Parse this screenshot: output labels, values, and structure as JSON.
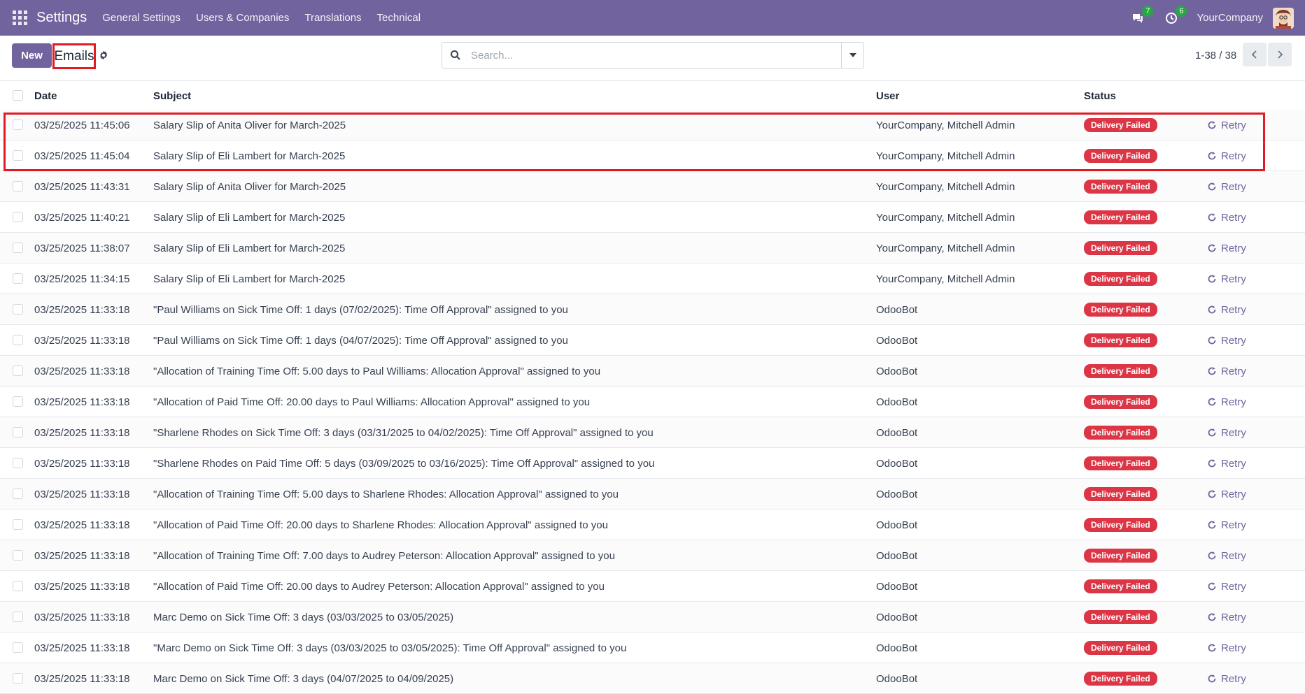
{
  "navbar": {
    "app_name": "Settings",
    "menu": [
      "General Settings",
      "Users & Companies",
      "Translations",
      "Technical"
    ],
    "messages_count": "7",
    "activities_count": "6",
    "company": "YourCompany"
  },
  "control": {
    "new_label": "New",
    "title": "Emails",
    "search_placeholder": "Search...",
    "pager": "1-38 / 38"
  },
  "table": {
    "columns": [
      "Date",
      "Subject",
      "User",
      "Status"
    ],
    "rows": [
      {
        "date": "03/25/2025 11:45:06",
        "subject": "Salary Slip of Anita Oliver for March-2025",
        "user": "YourCompany, Mitchell Admin",
        "status": "Delivery Failed",
        "action": "Retry"
      },
      {
        "date": "03/25/2025 11:45:04",
        "subject": "Salary Slip of Eli Lambert for March-2025",
        "user": "YourCompany, Mitchell Admin",
        "status": "Delivery Failed",
        "action": "Retry"
      },
      {
        "date": "03/25/2025 11:43:31",
        "subject": "Salary Slip of Anita Oliver for March-2025",
        "user": "YourCompany, Mitchell Admin",
        "status": "Delivery Failed",
        "action": "Retry"
      },
      {
        "date": "03/25/2025 11:40:21",
        "subject": "Salary Slip of Eli Lambert for March-2025",
        "user": "YourCompany, Mitchell Admin",
        "status": "Delivery Failed",
        "action": "Retry"
      },
      {
        "date": "03/25/2025 11:38:07",
        "subject": "Salary Slip of Eli Lambert for March-2025",
        "user": "YourCompany, Mitchell Admin",
        "status": "Delivery Failed",
        "action": "Retry"
      },
      {
        "date": "03/25/2025 11:34:15",
        "subject": "Salary Slip of Eli Lambert for March-2025",
        "user": "YourCompany, Mitchell Admin",
        "status": "Delivery Failed",
        "action": "Retry"
      },
      {
        "date": "03/25/2025 11:33:18",
        "subject": "\"Paul Williams on Sick Time Off: 1 days (07/02/2025): Time Off Approval\" assigned to you",
        "user": "OdooBot",
        "status": "Delivery Failed",
        "action": "Retry"
      },
      {
        "date": "03/25/2025 11:33:18",
        "subject": "\"Paul Williams on Sick Time Off: 1 days (04/07/2025): Time Off Approval\" assigned to you",
        "user": "OdooBot",
        "status": "Delivery Failed",
        "action": "Retry"
      },
      {
        "date": "03/25/2025 11:33:18",
        "subject": "\"Allocation of Training Time Off: 5.00 days to Paul Williams: Allocation Approval\" assigned to you",
        "user": "OdooBot",
        "status": "Delivery Failed",
        "action": "Retry"
      },
      {
        "date": "03/25/2025 11:33:18",
        "subject": "\"Allocation of Paid Time Off: 20.00 days to Paul Williams: Allocation Approval\" assigned to you",
        "user": "OdooBot",
        "status": "Delivery Failed",
        "action": "Retry"
      },
      {
        "date": "03/25/2025 11:33:18",
        "subject": "\"Sharlene Rhodes on Sick Time Off: 3 days (03/31/2025 to 04/02/2025): Time Off Approval\" assigned to you",
        "user": "OdooBot",
        "status": "Delivery Failed",
        "action": "Retry"
      },
      {
        "date": "03/25/2025 11:33:18",
        "subject": "\"Sharlene Rhodes on Paid Time Off: 5 days (03/09/2025 to 03/16/2025): Time Off Approval\" assigned to you",
        "user": "OdooBot",
        "status": "Delivery Failed",
        "action": "Retry"
      },
      {
        "date": "03/25/2025 11:33:18",
        "subject": "\"Allocation of Training Time Off: 5.00 days to Sharlene Rhodes: Allocation Approval\" assigned to you",
        "user": "OdooBot",
        "status": "Delivery Failed",
        "action": "Retry"
      },
      {
        "date": "03/25/2025 11:33:18",
        "subject": "\"Allocation of Paid Time Off: 20.00 days to Sharlene Rhodes: Allocation Approval\" assigned to you",
        "user": "OdooBot",
        "status": "Delivery Failed",
        "action": "Retry"
      },
      {
        "date": "03/25/2025 11:33:18",
        "subject": "\"Allocation of Training Time Off: 7.00 days to Audrey Peterson: Allocation Approval\" assigned to you",
        "user": "OdooBot",
        "status": "Delivery Failed",
        "action": "Retry"
      },
      {
        "date": "03/25/2025 11:33:18",
        "subject": "\"Allocation of Paid Time Off: 20.00 days to Audrey Peterson: Allocation Approval\" assigned to you",
        "user": "OdooBot",
        "status": "Delivery Failed",
        "action": "Retry"
      },
      {
        "date": "03/25/2025 11:33:18",
        "subject": "Marc Demo on Sick Time Off: 3 days (03/03/2025 to 03/05/2025)",
        "user": "OdooBot",
        "status": "Delivery Failed",
        "action": "Retry"
      },
      {
        "date": "03/25/2025 11:33:18",
        "subject": "\"Marc Demo on Sick Time Off: 3 days (03/03/2025 to 03/05/2025): Time Off Approval\" assigned to you",
        "user": "OdooBot",
        "status": "Delivery Failed",
        "action": "Retry"
      },
      {
        "date": "03/25/2025 11:33:18",
        "subject": "Marc Demo on Sick Time Off: 3 days (04/07/2025 to 04/09/2025)",
        "user": "OdooBot",
        "status": "Delivery Failed",
        "action": "Retry"
      }
    ]
  },
  "colors": {
    "navbar": "#71639e",
    "status_failed": "#dc3545",
    "highlight": "#e01b24",
    "badge": "#28a745"
  },
  "icons": [
    "apps-grid-icon",
    "chat-icon",
    "clock-icon",
    "gear-icon",
    "search-icon",
    "chevron-left-icon",
    "chevron-right-icon",
    "retry-icon"
  ]
}
